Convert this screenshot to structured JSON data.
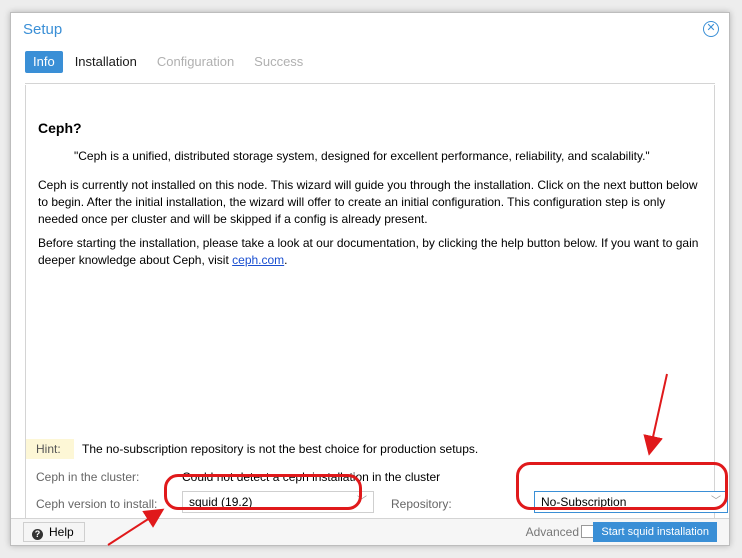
{
  "window": {
    "title": "Setup",
    "close_icon": "close-circle-icon"
  },
  "tabs": [
    {
      "label": "Info",
      "state": "active"
    },
    {
      "label": "Installation",
      "state": "current"
    },
    {
      "label": "Configuration",
      "state": "disabled"
    },
    {
      "label": "Success",
      "state": "disabled"
    }
  ],
  "info": {
    "heading": "Ceph?",
    "quote": "\"Ceph is a unified, distributed storage system, designed for excellent performance, reliability, and scalability.\"",
    "paragraph1": "Ceph is currently not installed on this node. This wizard will guide you through the installation. Click on the next button below to begin. After the initial installation, the wizard will offer to create an initial configuration. This configuration step is only needed once per cluster and will be skipped if a config is already present.",
    "paragraph2_prefix": "Before starting the installation, please take a look at our documentation, by clicking the help button below. If you want to gain deeper knowledge about Ceph, visit ",
    "paragraph2_link": "ceph.com",
    "paragraph2_suffix": "."
  },
  "hint": {
    "label": "Hint:",
    "text": "The no-subscription repository is not the best choice for production setups."
  },
  "cluster": {
    "label": "Ceph in the cluster:",
    "value": "Could not detect a ceph installation in the cluster"
  },
  "version": {
    "label": "Ceph version to install:",
    "value": "squid (19.2)"
  },
  "repository": {
    "label": "Repository:",
    "value": "No-Subscription"
  },
  "footer": {
    "help_label": "Help",
    "advanced_label": "Advanced",
    "advanced_checked": false,
    "start_label": "Start squid installation"
  },
  "colors": {
    "accent": "#3a8fd6",
    "annotation": "#e0191b",
    "hint_bg": "#fdf7d6"
  }
}
